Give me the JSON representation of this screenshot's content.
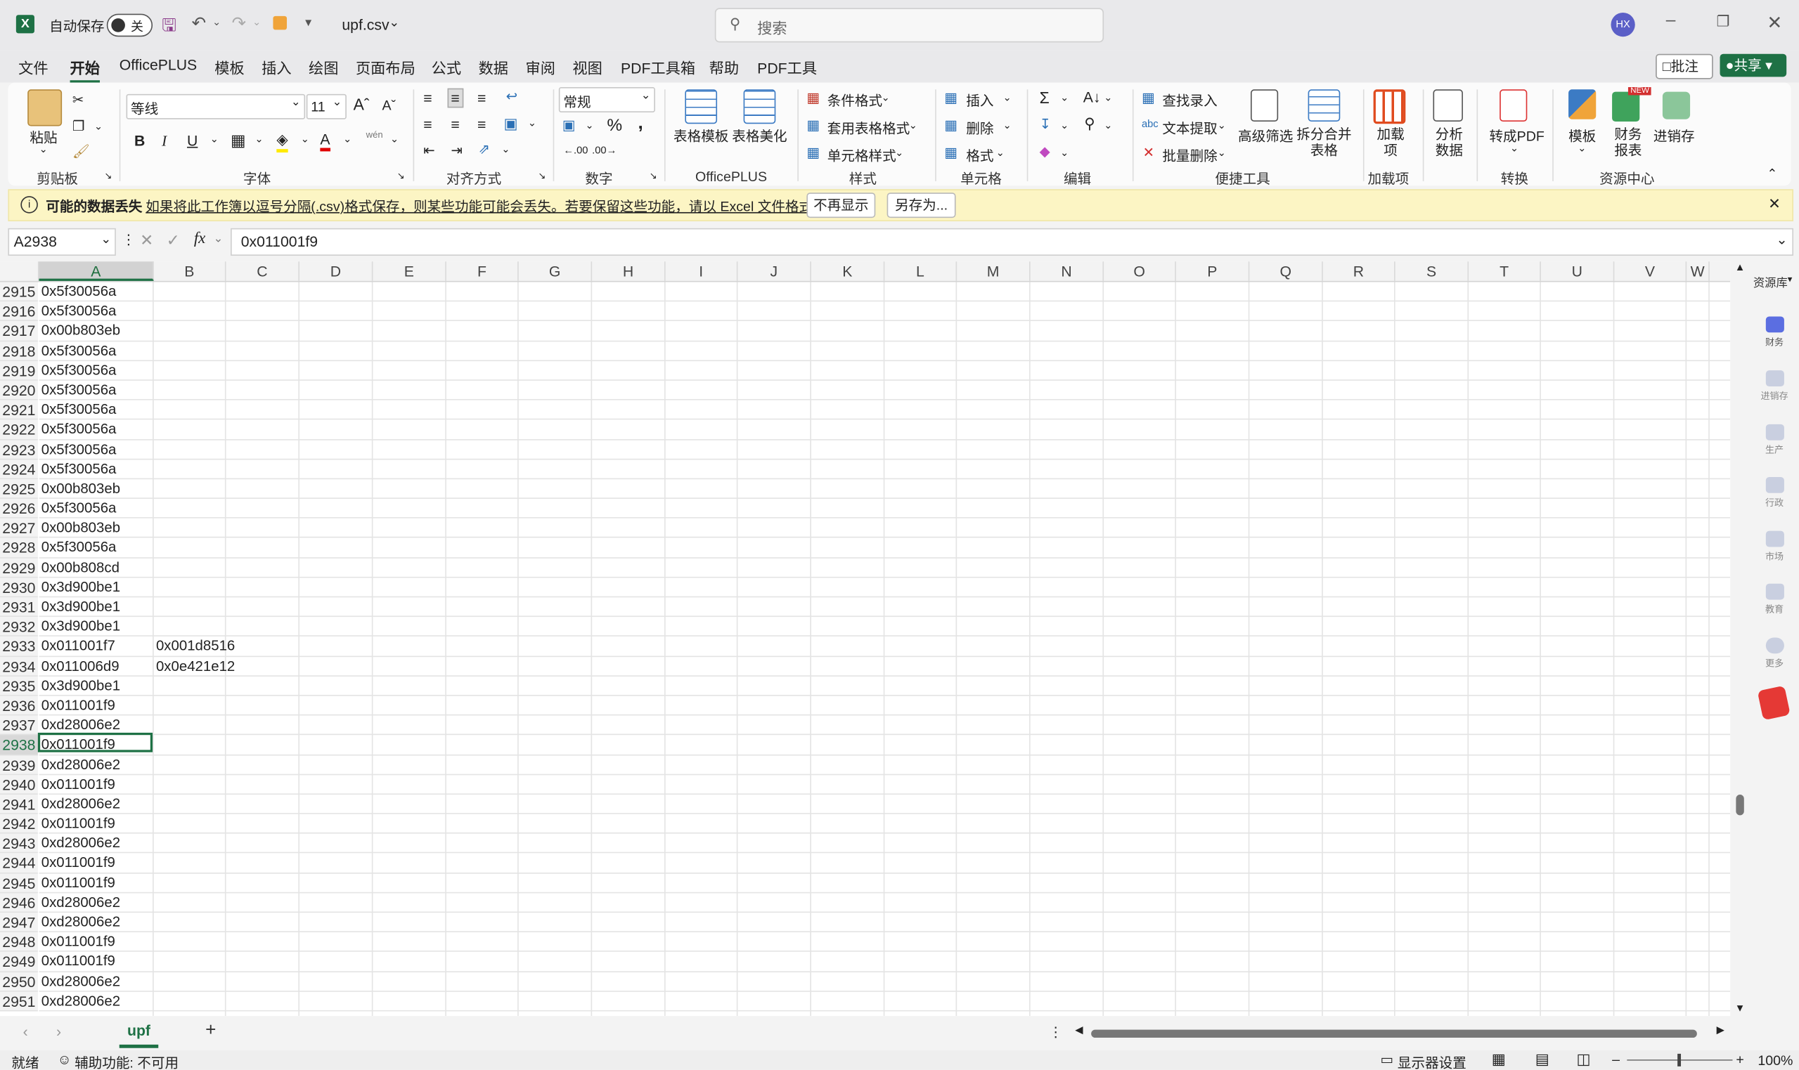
{
  "titlebar": {
    "autosave_label": "自动保存",
    "autosave_state": "关",
    "filename": "upf.csv",
    "search_placeholder": "搜索",
    "avatar": "HX"
  },
  "menu": {
    "items": [
      "文件",
      "开始",
      "OfficePLUS",
      "模板",
      "插入",
      "绘图",
      "页面布局",
      "公式",
      "数据",
      "审阅",
      "视图",
      "PDF工具箱",
      "帮助",
      "PDF工具"
    ],
    "active": "开始",
    "comment_button": "批注",
    "share_button": "共享"
  },
  "ribbon": {
    "paste": "粘贴",
    "clipboard": "剪贴板",
    "font_name": "等线",
    "font_size": "11",
    "font_group": "字体",
    "align_group": "对齐方式",
    "number_format": "常规",
    "number_group": "数字",
    "table_template": "表格模板",
    "table_beautify": "表格美化",
    "officeplus_group": "OfficePLUS",
    "conditional_format": "条件格式",
    "table_format": "套用表格格式",
    "cell_style": "单元格样式",
    "styles_group": "样式",
    "insert": "插入",
    "delete": "删除",
    "format": "格式",
    "cells_group": "单元格",
    "edit_group": "编辑",
    "find_entry": "查找录入",
    "text_extract": "文本提取",
    "batch_delete": "批量删除",
    "advanced_filter": "高级筛选",
    "split_merge": "拆分合并表格",
    "quick_tools_group": "便捷工具",
    "addin": "加载项",
    "addin_group": "加载项",
    "analyze": "分析数据",
    "to_pdf": "转成PDF",
    "convert_group": "转换",
    "template": "模板",
    "finance_report": "财务报表",
    "inventory": "进销存",
    "resource_group": "资源中心",
    "new_badge": "NEW",
    "phonetic": "wén"
  },
  "infobar": {
    "title": "可能的数据丢失",
    "message": "如果将此工作簿以逗号分隔(.csv)格式保存，则某些功能可能会丢失。若要保留这些功能，请以 Excel 文件格式保存。",
    "dont_show": "不再显示",
    "save_as": "另存为..."
  },
  "formula": {
    "name_box": "A2938",
    "fx": "fx",
    "value": "0x011001f9"
  },
  "grid": {
    "columns": [
      "A",
      "B",
      "C",
      "D",
      "E",
      "F",
      "G",
      "H",
      "I",
      "J",
      "K",
      "L",
      "M",
      "N",
      "O",
      "P",
      "Q",
      "R",
      "S",
      "T",
      "U",
      "V",
      "W"
    ],
    "selected_column": "A",
    "selected_row": "2938",
    "rows": [
      {
        "n": "2915",
        "a": "0x5f30056a",
        "b": ""
      },
      {
        "n": "2916",
        "a": "0x5f30056a",
        "b": ""
      },
      {
        "n": "2917",
        "a": "0x00b803eb",
        "b": ""
      },
      {
        "n": "2918",
        "a": "0x5f30056a",
        "b": ""
      },
      {
        "n": "2919",
        "a": "0x5f30056a",
        "b": ""
      },
      {
        "n": "2920",
        "a": "0x5f30056a",
        "b": ""
      },
      {
        "n": "2921",
        "a": "0x5f30056a",
        "b": ""
      },
      {
        "n": "2922",
        "a": "0x5f30056a",
        "b": ""
      },
      {
        "n": "2923",
        "a": "0x5f30056a",
        "b": ""
      },
      {
        "n": "2924",
        "a": "0x5f30056a",
        "b": ""
      },
      {
        "n": "2925",
        "a": "0x00b803eb",
        "b": ""
      },
      {
        "n": "2926",
        "a": "0x5f30056a",
        "b": ""
      },
      {
        "n": "2927",
        "a": "0x00b803eb",
        "b": ""
      },
      {
        "n": "2928",
        "a": "0x5f30056a",
        "b": ""
      },
      {
        "n": "2929",
        "a": "0x00b808cd",
        "b": ""
      },
      {
        "n": "2930",
        "a": "0x3d900be1",
        "b": ""
      },
      {
        "n": "2931",
        "a": "0x3d900be1",
        "b": ""
      },
      {
        "n": "2932",
        "a": "0x3d900be1",
        "b": ""
      },
      {
        "n": "2933",
        "a": "0x011001f7",
        "b": "0x001d8516"
      },
      {
        "n": "2934",
        "a": "0x011006d9",
        "b": "0x0e421e12"
      },
      {
        "n": "2935",
        "a": "0x3d900be1",
        "b": ""
      },
      {
        "n": "2936",
        "a": "0x011001f9",
        "b": ""
      },
      {
        "n": "2937",
        "a": "0xd28006e2",
        "b": ""
      },
      {
        "n": "2938",
        "a": "0x011001f9",
        "b": ""
      },
      {
        "n": "2939",
        "a": "0xd28006e2",
        "b": ""
      },
      {
        "n": "2940",
        "a": "0x011001f9",
        "b": ""
      },
      {
        "n": "2941",
        "a": "0xd28006e2",
        "b": ""
      },
      {
        "n": "2942",
        "a": "0x011001f9",
        "b": ""
      },
      {
        "n": "2943",
        "a": "0xd28006e2",
        "b": ""
      },
      {
        "n": "2944",
        "a": "0x011001f9",
        "b": ""
      },
      {
        "n": "2945",
        "a": "0x011001f9",
        "b": ""
      },
      {
        "n": "2946",
        "a": "0xd28006e2",
        "b": ""
      },
      {
        "n": "2947",
        "a": "0xd28006e2",
        "b": ""
      },
      {
        "n": "2948",
        "a": "0x011001f9",
        "b": ""
      },
      {
        "n": "2949",
        "a": "0x011001f9",
        "b": ""
      },
      {
        "n": "2950",
        "a": "0xd28006e2",
        "b": ""
      },
      {
        "n": "2951",
        "a": "0xd28006e2",
        "b": ""
      }
    ]
  },
  "sidepanel": {
    "title": "资源库",
    "items": [
      "财务",
      "进销存",
      "生产",
      "行政",
      "市场",
      "教育",
      "更多"
    ]
  },
  "sheets": {
    "tabs": [
      "upf"
    ],
    "add": "+"
  },
  "statusbar": {
    "ready": "就绪",
    "accessibility": "辅助功能: 不可用",
    "display_settings": "显示器设置",
    "zoom": "100%"
  },
  "colors": {
    "accent": "#1e7145",
    "info_bg": "#fcf5c4",
    "avatar_bg": "#5b5fc7"
  }
}
